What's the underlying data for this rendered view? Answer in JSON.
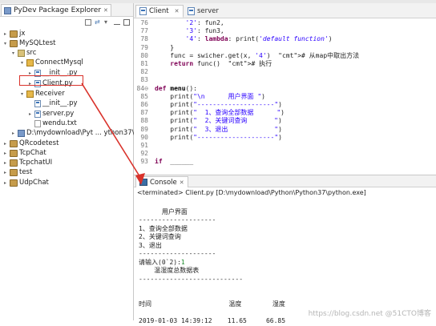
{
  "explorer": {
    "tab_label": "PyDev Package Explorer",
    "tree": [
      {
        "label": "jx",
        "arrow": "▸",
        "icon": "project"
      },
      {
        "label": "MySQLtest",
        "arrow": "▾",
        "icon": "project"
      },
      {
        "label": "src",
        "arrow": "▾",
        "icon": "source-folder"
      },
      {
        "label": "ConnectMysql",
        "arrow": "▾",
        "icon": "package"
      },
      {
        "label": "__init__.py",
        "arrow": "▸",
        "icon": "py-file"
      },
      {
        "label": "Client.py",
        "arrow": "▸",
        "icon": "py-file"
      },
      {
        "label": "Receiver",
        "arrow": "▾",
        "icon": "package"
      },
      {
        "label": "__init__.py",
        "arrow": "",
        "icon": "py-file"
      },
      {
        "label": "server.py",
        "arrow": "▸",
        "icon": "py-file"
      },
      {
        "label": "wendu.txt",
        "arrow": "",
        "icon": "text-file"
      },
      {
        "label": "D:\\mydownload\\Pyt ... ython37\\python.exe",
        "arrow": "▸",
        "icon": "interpreter"
      },
      {
        "label": "QRcodetest",
        "arrow": "▸",
        "icon": "project"
      },
      {
        "label": "TcpChat",
        "arrow": "▸",
        "icon": "project"
      },
      {
        "label": "TcpchatUI",
        "arrow": "▸",
        "icon": "project"
      },
      {
        "label": "test",
        "arrow": "▸",
        "icon": "project"
      },
      {
        "label": "UdpChat",
        "arrow": "▸",
        "icon": "project"
      }
    ]
  },
  "editor": {
    "tabs": [
      {
        "label": "Client"
      },
      {
        "label": "server"
      }
    ],
    "lines": [
      {
        "num": "76",
        "text": "        '2': fun2,"
      },
      {
        "num": "77",
        "text": "        '3': fun3,"
      },
      {
        "num": "78",
        "text": "        '4': lambda: print('default function')"
      },
      {
        "num": "79",
        "text": "    }"
      },
      {
        "num": "80",
        "text": "    func = swicher.get(x, '4')  # 从map中取出方法"
      },
      {
        "num": "81",
        "text": "    return func()  # 执行"
      },
      {
        "num": "82",
        "text": ""
      },
      {
        "num": "83",
        "text": ""
      },
      {
        "num": "84⊖",
        "text": "def menu():"
      },
      {
        "num": "85",
        "text": "    print(\"\\n      用户界面 \")"
      },
      {
        "num": "86",
        "text": "    print(\"--------------------\")"
      },
      {
        "num": "87",
        "text": "    print(\"  1、查询全部数据      \")"
      },
      {
        "num": "88",
        "text": "    print(\"  2、关键词查询       \")"
      },
      {
        "num": "89",
        "text": "    print(\"  3、退出            \")"
      },
      {
        "num": "90",
        "text": "    print(\"--------------------\")"
      },
      {
        "num": "91",
        "text": ""
      },
      {
        "num": "92",
        "text": ""
      },
      {
        "num": "93",
        "text": "if  ______"
      }
    ]
  },
  "console": {
    "tab_label": "Console",
    "status": "<terminated> Client.py [D:\\mydownload\\Python\\Python37\\python.exe]",
    "output": [
      "",
      "      用户界面",
      "--------------------",
      "1、查询全部数据",
      "2、关键词查询",
      "3、退出",
      "--------------------",
      "请输入(0`2):",
      "    温湿度总数据表",
      "---------------------------",
      "",
      "",
      "时间                    温度        湿度",
      "",
      "2019-01-03 14:39:12    11.65     66.85"
    ],
    "input_value": "1",
    "watermark": "https://blog.csdn.net @51CTO博客"
  },
  "colors": {
    "keyword": "#7f0055",
    "string": "#2a00ff",
    "string_green": "#00a000",
    "highlight_red": "#d9322b"
  }
}
